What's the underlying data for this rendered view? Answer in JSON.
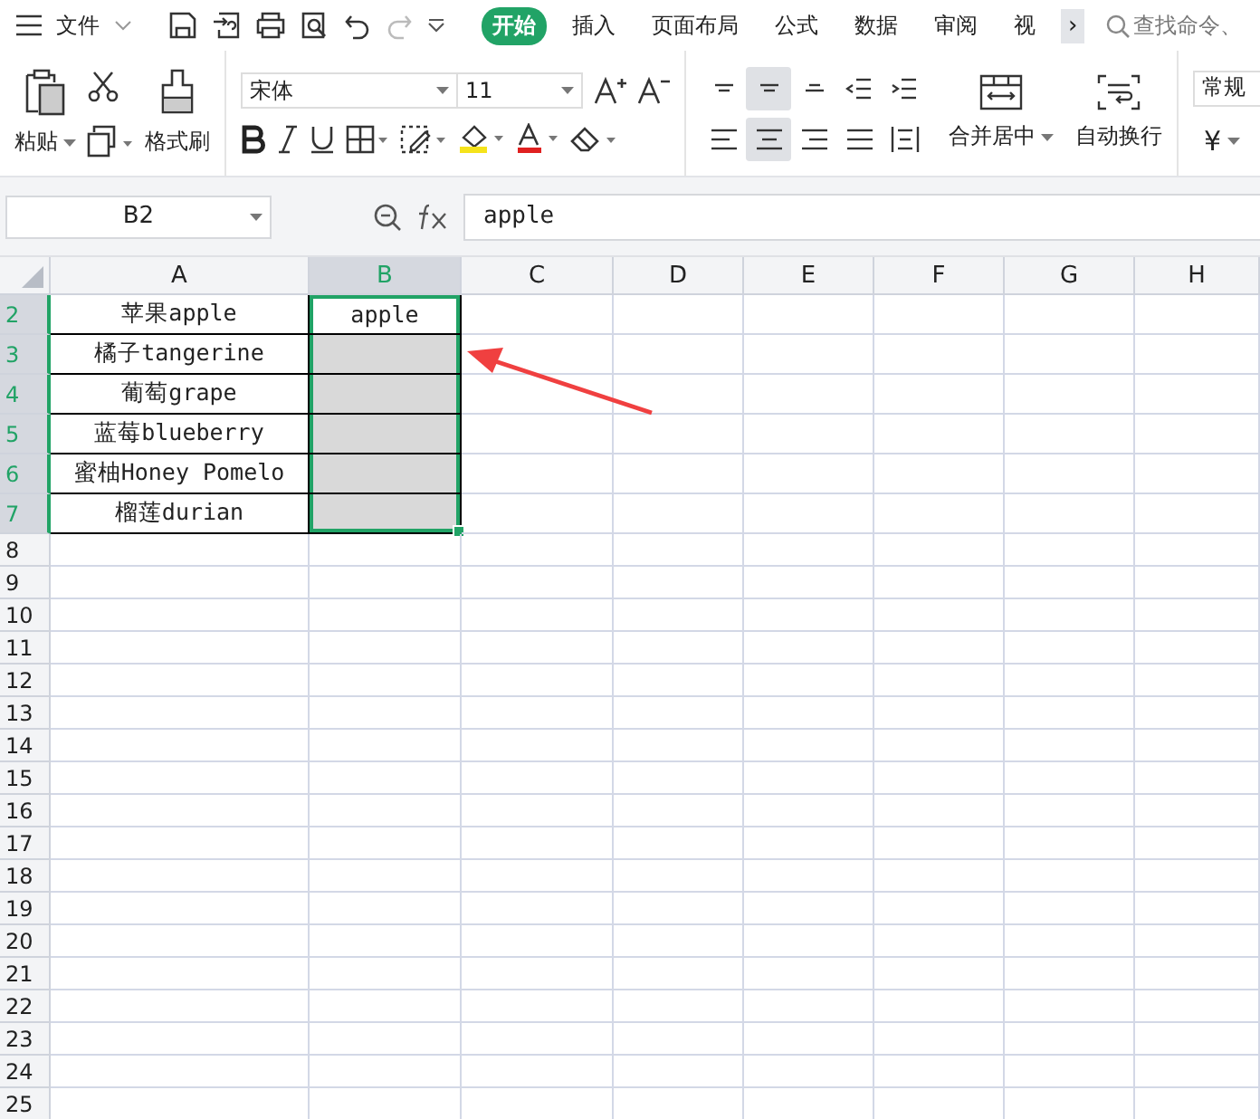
{
  "menu": {
    "file_label": "文件",
    "tabs": [
      {
        "label": "开始",
        "selected": true
      },
      {
        "label": "插入",
        "selected": false
      },
      {
        "label": "页面布局",
        "selected": false
      },
      {
        "label": "公式",
        "selected": false
      },
      {
        "label": "数据",
        "selected": false
      },
      {
        "label": "审阅",
        "selected": false
      },
      {
        "label": "视",
        "selected": false
      }
    ],
    "more_label": "›",
    "search": {
      "placeholder": "查找命令、"
    }
  },
  "ribbon": {
    "paste_label": "粘贴",
    "format_painter_label": "格式刷",
    "font_name": "宋体",
    "font_size": "11",
    "align_buttons": [
      {
        "kind": "top",
        "selected": false
      },
      {
        "kind": "middle",
        "selected": true
      },
      {
        "kind": "bottom",
        "selected": false
      },
      {
        "kind": "outdent",
        "selected": false
      },
      {
        "kind": "indent",
        "selected": false
      },
      {
        "kind": "left",
        "selected": false
      },
      {
        "kind": "center",
        "selected": true
      },
      {
        "kind": "right",
        "selected": false
      },
      {
        "kind": "justify",
        "selected": false
      },
      {
        "kind": "distribute",
        "selected": false
      }
    ],
    "merge_label": "合并居中",
    "wrap_label": "自动换行",
    "number_format": "常规",
    "currency_symbol": "¥"
  },
  "formula_bar": {
    "name_box": "B2",
    "formula": "apple"
  },
  "sheet": {
    "columns": [
      {
        "label": "A",
        "selected": false
      },
      {
        "label": "B",
        "selected": true
      },
      {
        "label": "C",
        "selected": false
      },
      {
        "label": "D",
        "selected": false
      },
      {
        "label": "E",
        "selected": false
      },
      {
        "label": "F",
        "selected": false
      },
      {
        "label": "G",
        "selected": false
      },
      {
        "label": "H",
        "selected": false
      }
    ],
    "rows": [
      {
        "number": "2",
        "selected": true,
        "cells": [
          {
            "text": "苹果apple",
            "bordered": true,
            "selected": false,
            "active": false
          },
          {
            "text": "apple",
            "bordered": true,
            "selected": true,
            "active": true
          }
        ]
      },
      {
        "number": "3",
        "selected": true,
        "cells": [
          {
            "text": "橘子tangerine",
            "bordered": true,
            "selected": false,
            "active": false
          },
          {
            "bordered": true,
            "selected": true,
            "active": false
          }
        ]
      },
      {
        "number": "4",
        "selected": true,
        "cells": [
          {
            "text": "葡萄grape",
            "bordered": true,
            "selected": false,
            "active": false
          },
          {
            "bordered": true,
            "selected": true,
            "active": false
          }
        ]
      },
      {
        "number": "5",
        "selected": true,
        "cells": [
          {
            "text": "蓝莓blueberry",
            "bordered": true,
            "selected": false,
            "active": false
          },
          {
            "bordered": true,
            "selected": true,
            "active": false
          }
        ]
      },
      {
        "number": "6",
        "selected": true,
        "cells": [
          {
            "text": "蜜柚Honey Pomelo",
            "bordered": true,
            "selected": false,
            "active": false
          },
          {
            "bordered": true,
            "selected": true,
            "active": false
          }
        ]
      },
      {
        "number": "7",
        "selected": true,
        "cells": [
          {
            "text": "榴莲durian",
            "bordered": true,
            "selected": false,
            "active": false
          },
          {
            "bordered": true,
            "selected": true,
            "active": false
          }
        ]
      },
      {
        "number": "8",
        "selected": false
      },
      {
        "number": "9",
        "selected": false
      },
      {
        "number": "10",
        "selected": false
      },
      {
        "number": "11",
        "selected": false
      },
      {
        "number": "12",
        "selected": false
      },
      {
        "number": "13",
        "selected": false
      },
      {
        "number": "14",
        "selected": false
      },
      {
        "number": "15",
        "selected": false
      },
      {
        "number": "16",
        "selected": false
      },
      {
        "number": "17",
        "selected": false
      },
      {
        "number": "18",
        "selected": false
      },
      {
        "number": "19",
        "selected": false
      },
      {
        "number": "20",
        "selected": false
      },
      {
        "number": "21",
        "selected": false
      },
      {
        "number": "22",
        "selected": false
      },
      {
        "number": "23",
        "selected": false
      },
      {
        "number": "24",
        "selected": false
      },
      {
        "number": "25",
        "selected": false
      }
    ]
  }
}
